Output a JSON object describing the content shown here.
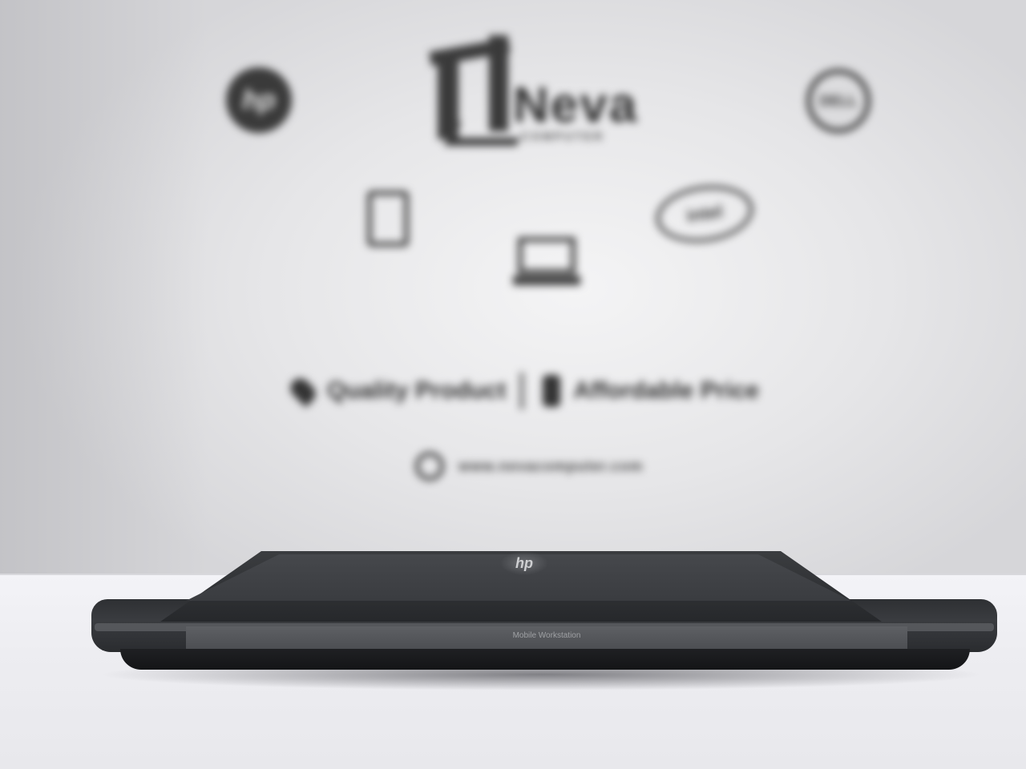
{
  "banner": {
    "logos": [
      "hp-logo",
      "dell-logo",
      "intel-logo",
      "phone-icon",
      "laptop-icon"
    ],
    "brand_name": "Neva",
    "brand_sub": "COMPUTER",
    "tagline_left": "Quality Product",
    "tagline_right": "Affordable Price",
    "website": "www.nevacomputer.com"
  },
  "laptop": {
    "lid_logo": "hp",
    "model_label": "Mobile Workstation"
  }
}
